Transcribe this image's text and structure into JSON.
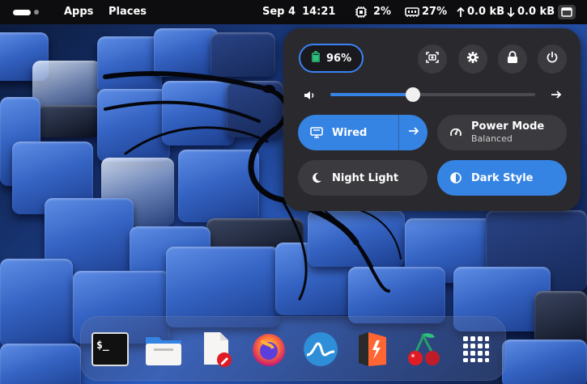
{
  "topbar": {
    "apps_label": "Apps",
    "places_label": "Places",
    "date": "Sep 4",
    "time": "14:21",
    "cpu_value": "2%",
    "memory_value": "27%",
    "upload_value": "0.0 kB",
    "download_value": "0.0 kB"
  },
  "quick_settings": {
    "battery_level": "96%",
    "volume_fraction": 0.405,
    "tiles": {
      "wired": {
        "label": "Wired",
        "active": true
      },
      "power_mode": {
        "label": "Power Mode",
        "subtitle": "Balanced",
        "active": false
      },
      "night_light": {
        "label": "Night Light",
        "active": false
      },
      "dark_style": {
        "label": "Dark Style",
        "active": true
      }
    }
  },
  "dock": {
    "apps": [
      {
        "name": "terminal",
        "icon": "terminal-icon"
      },
      {
        "name": "files",
        "icon": "folder-icon"
      },
      {
        "name": "text-editor",
        "icon": "text-editor-icon"
      },
      {
        "name": "firefox",
        "icon": "firefox-icon"
      },
      {
        "name": "wireshark",
        "icon": "wireshark-icon"
      },
      {
        "name": "burp-suite",
        "icon": "burpsuite-icon"
      },
      {
        "name": "cherrytree",
        "icon": "cherry-icon"
      },
      {
        "name": "show-apps",
        "icon": "app-grid-icon"
      }
    ]
  },
  "colors": {
    "accent": "#3584e4",
    "panel_bg": "#2a2a2e",
    "topbar_bg": "#0d0d0f"
  }
}
